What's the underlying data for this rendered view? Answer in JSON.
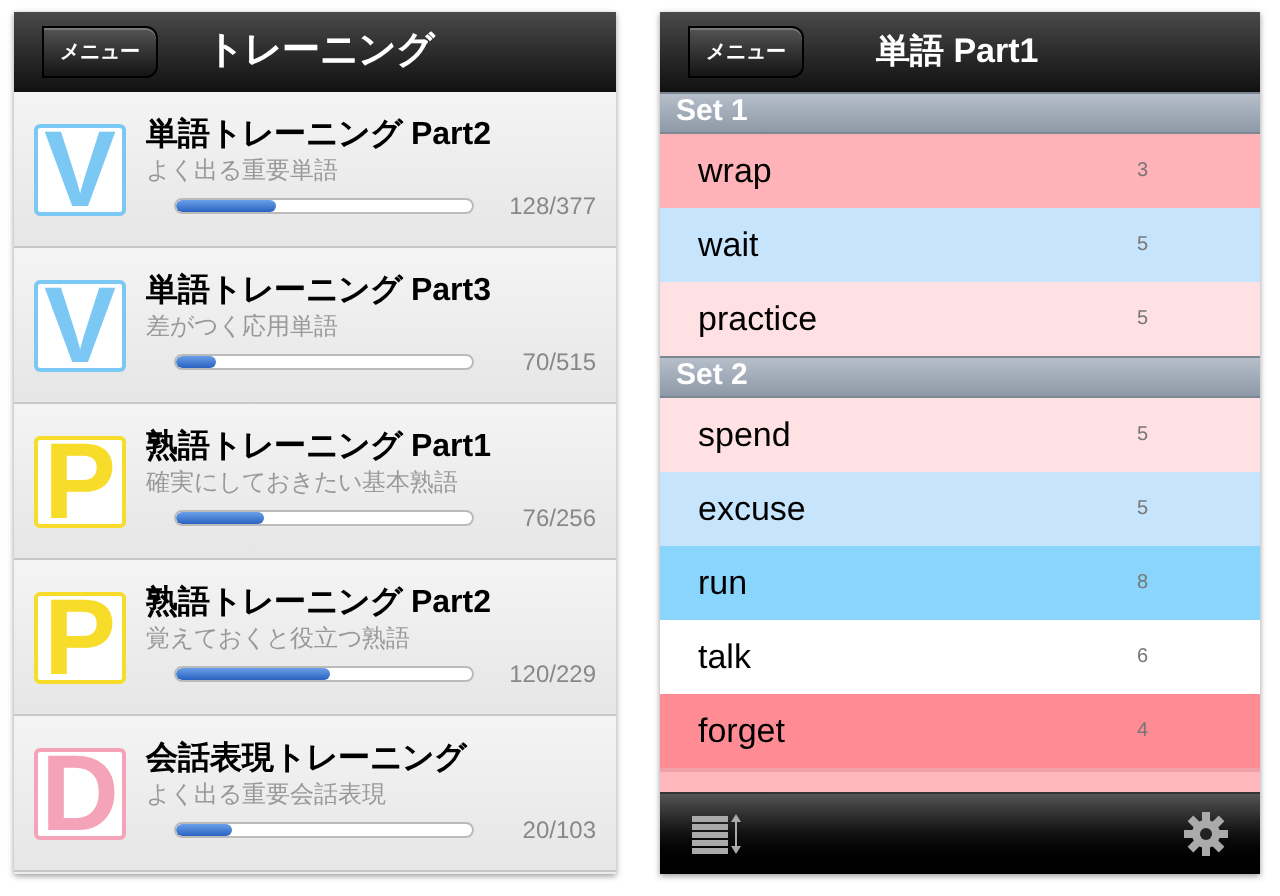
{
  "left_screen": {
    "back_button": "メニュー",
    "title": "トレーニング",
    "courses": [
      {
        "icon_letter": "V",
        "color": "#7cc8f4",
        "title": "単語トレーニング Part2",
        "subtitle": "よく出る重要単語",
        "level": 0.34,
        "progress": "128/377"
      },
      {
        "icon_letter": "V",
        "color": "#7cc8f4",
        "title": "単語トレーニング Part3",
        "subtitle": "差がつく応用単語",
        "level": 0.136,
        "progress": "70/515"
      },
      {
        "icon_letter": "P",
        "color": "#f7dc2a",
        "title": "熟語トレーニング Part1",
        "subtitle": "確実にしておきたい基本熟語",
        "level": 0.3,
        "progress": "76/256"
      },
      {
        "icon_letter": "P",
        "color": "#f7dc2a",
        "title": "熟語トレーニング Part2",
        "subtitle": "覚えておくと役立つ熟語",
        "level": 0.52,
        "progress": "120/229"
      },
      {
        "icon_letter": "D",
        "color": "#f5a3b8",
        "title": "会話表現トレーニング",
        "subtitle": "よく出る重要会話表現",
        "level": 0.19,
        "progress": "20/103"
      }
    ]
  },
  "right_screen": {
    "back_button": "メニュー",
    "title": "単語 Part1",
    "sets": [
      {
        "name": "Set 1",
        "words": [
          {
            "word": "wrap",
            "count": "3",
            "color": "#ffb3b8"
          },
          {
            "word": "wait",
            "count": "5",
            "color": "#c6e4fc"
          },
          {
            "word": "practice",
            "count": "5",
            "color": "#ffe0e3"
          }
        ]
      },
      {
        "name": "Set 2",
        "words": [
          {
            "word": "spend",
            "count": "5",
            "color": "#ffe0e3"
          },
          {
            "word": "excuse",
            "count": "5",
            "color": "#c6e4fc"
          },
          {
            "word": "run",
            "count": "8",
            "color": "#8ad5fb"
          },
          {
            "word": "talk",
            "count": "6",
            "color": "#ffffff"
          },
          {
            "word": "forget",
            "count": "4",
            "color": "#ff8c94"
          }
        ]
      }
    ],
    "partial_row": {
      "color": "#ffb8bd"
    }
  }
}
